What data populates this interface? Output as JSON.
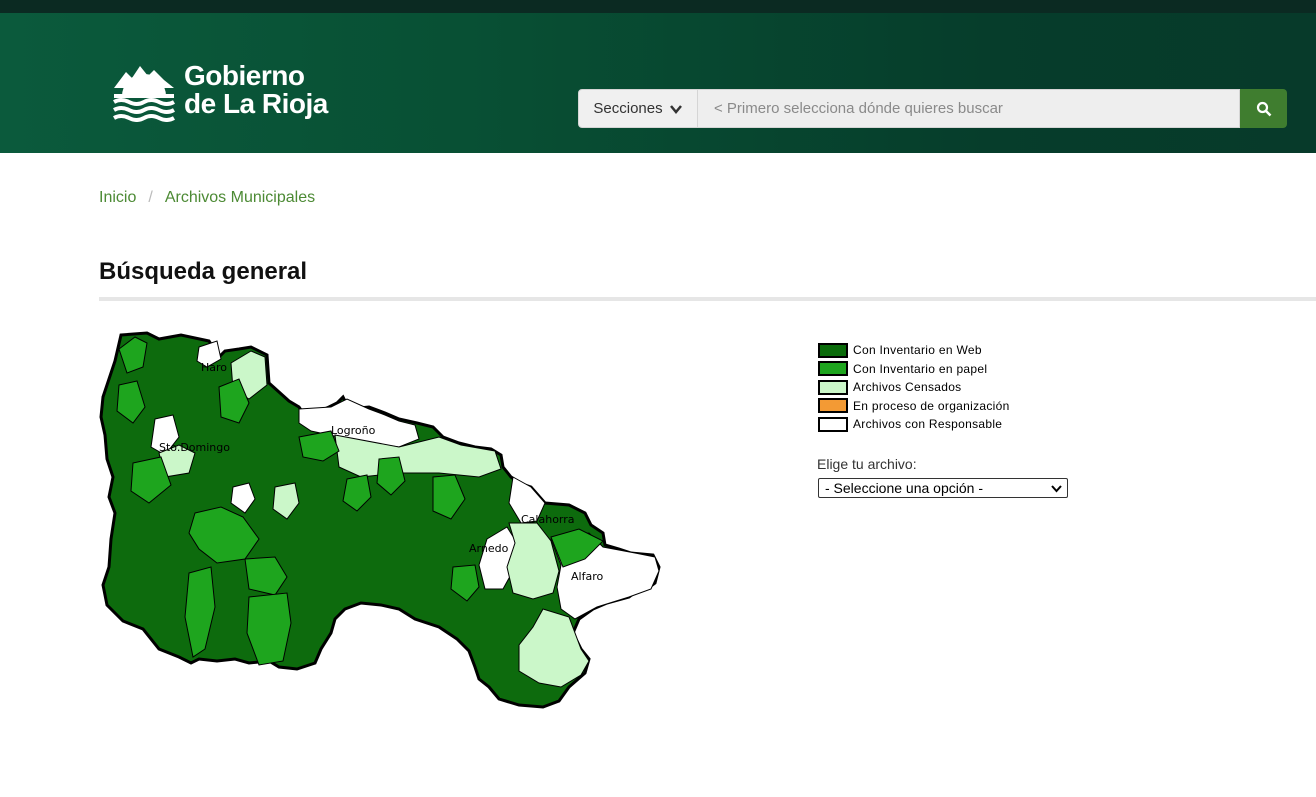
{
  "header": {
    "logo_line1": "Gobierno",
    "logo_line2": "de La Rioja",
    "sections_label": "Secciones",
    "search_placeholder": "< Primero selecciona dónde quieres buscar"
  },
  "breadcrumb": {
    "items": [
      "Inicio",
      "Archivos Municipales"
    ]
  },
  "page": {
    "title": "Búsqueda general"
  },
  "map": {
    "labels": [
      "Haro",
      "Logroño",
      "Sto.Domingo",
      "Calahorra",
      "Arnedo",
      "Alfaro"
    ]
  },
  "legend": {
    "items": [
      {
        "label": "Con Inventario en Web",
        "color": "#0a6b0a"
      },
      {
        "label": "Con Inventario en papel",
        "color": "#1ea51e"
      },
      {
        "label": "Archivos Censados",
        "color": "#cbf7c9"
      },
      {
        "label": "En proceso de organización",
        "color": "#f39a34"
      },
      {
        "label": "Archivos con Responsable",
        "color": "#ffffff"
      }
    ]
  },
  "picker": {
    "label": "Elige tu archivo:",
    "selected": "- Seleccione una opción -"
  },
  "colors": {
    "header_dark": "#063d2b",
    "accent_green": "#3f7d2f",
    "link_green": "#4c8a34"
  }
}
